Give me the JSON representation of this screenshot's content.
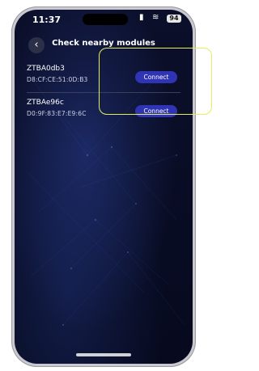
{
  "status_bar": {
    "time": "11:37",
    "battery": "94"
  },
  "header": {
    "title": "Check nearby modules"
  },
  "modules": [
    {
      "name": "ZTBA0db3",
      "mac": "D8:CF:CE:51:0D:B3",
      "button_label": "Connect"
    },
    {
      "name": "ZTBAe96c",
      "mac": "D0:9F:83:E7:E9:6C",
      "button_label": "Connect"
    }
  ],
  "colors": {
    "accent": "#2f34b5",
    "background": "#0b0f2a",
    "callout": "#e6ef5a"
  }
}
